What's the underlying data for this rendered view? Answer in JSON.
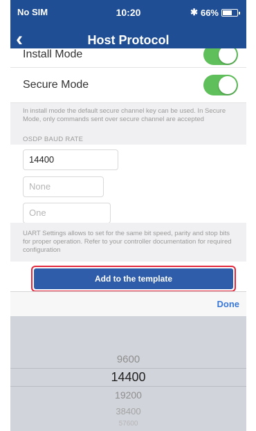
{
  "status": {
    "carrier": "No SIM",
    "time": "10:20",
    "battery_text": "66%",
    "battery_level": 0.66
  },
  "nav": {
    "back_icon": "‹",
    "title": "Host Protocol"
  },
  "rows": {
    "install_label": "Install Mode",
    "secure_label": "Secure Mode"
  },
  "install_note": "In install mode the default secure channel key can be used. In Secure Mode, only commands sent over secure channel are accepted",
  "baud": {
    "header": "OSDP BAUD RATE",
    "value": "14400",
    "parity_placeholder": "None",
    "stop_placeholder": "One"
  },
  "uart_note": "UART Settings allows to set for the same bit speed, parity and stop bits for proper operation. Refer to your controller documentation for required configuration",
  "add_button": "Add to the template",
  "picker": {
    "done_label": "Done",
    "items": [
      "9600",
      "14400",
      "19200",
      "38400",
      "57600"
    ],
    "selected": "14400"
  },
  "colors": {
    "nav": "#1f4e95",
    "switch_on": "#5fbf5a",
    "button": "#2f5da9",
    "done": "#3a78d6",
    "highlight": "#e2263b"
  }
}
